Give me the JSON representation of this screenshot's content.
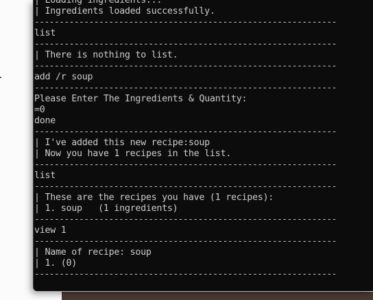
{
  "terminal": {
    "lines": [
      "| Loading ingredients...",
      "| Ingredients loaded successfully.",
      "-------------------------------------------------------------",
      "list",
      "-------------------------------------------------------------",
      "| There is nothing to list.",
      "-------------------------------------------------------------",
      "add /r soup",
      "-------------------------------------------------------------",
      "Please Enter The Ingredients & Quantity:",
      "=0",
      "done",
      "-------------------------------------------------------------",
      "| I've added this new recipe:soup",
      "| Now you have 1 recipes in the list.",
      "-------------------------------------------------------------",
      "list",
      "-------------------------------------------------------------",
      "| These are the recipes you have (1 recipes):",
      "| 1. soup   (1 ingredients)",
      "-------------------------------------------------------------",
      "view 1",
      "-------------------------------------------------------------",
      "| Name of recipe: soup",
      "| 1. (0)",
      "-------------------------------------------------------------"
    ]
  }
}
